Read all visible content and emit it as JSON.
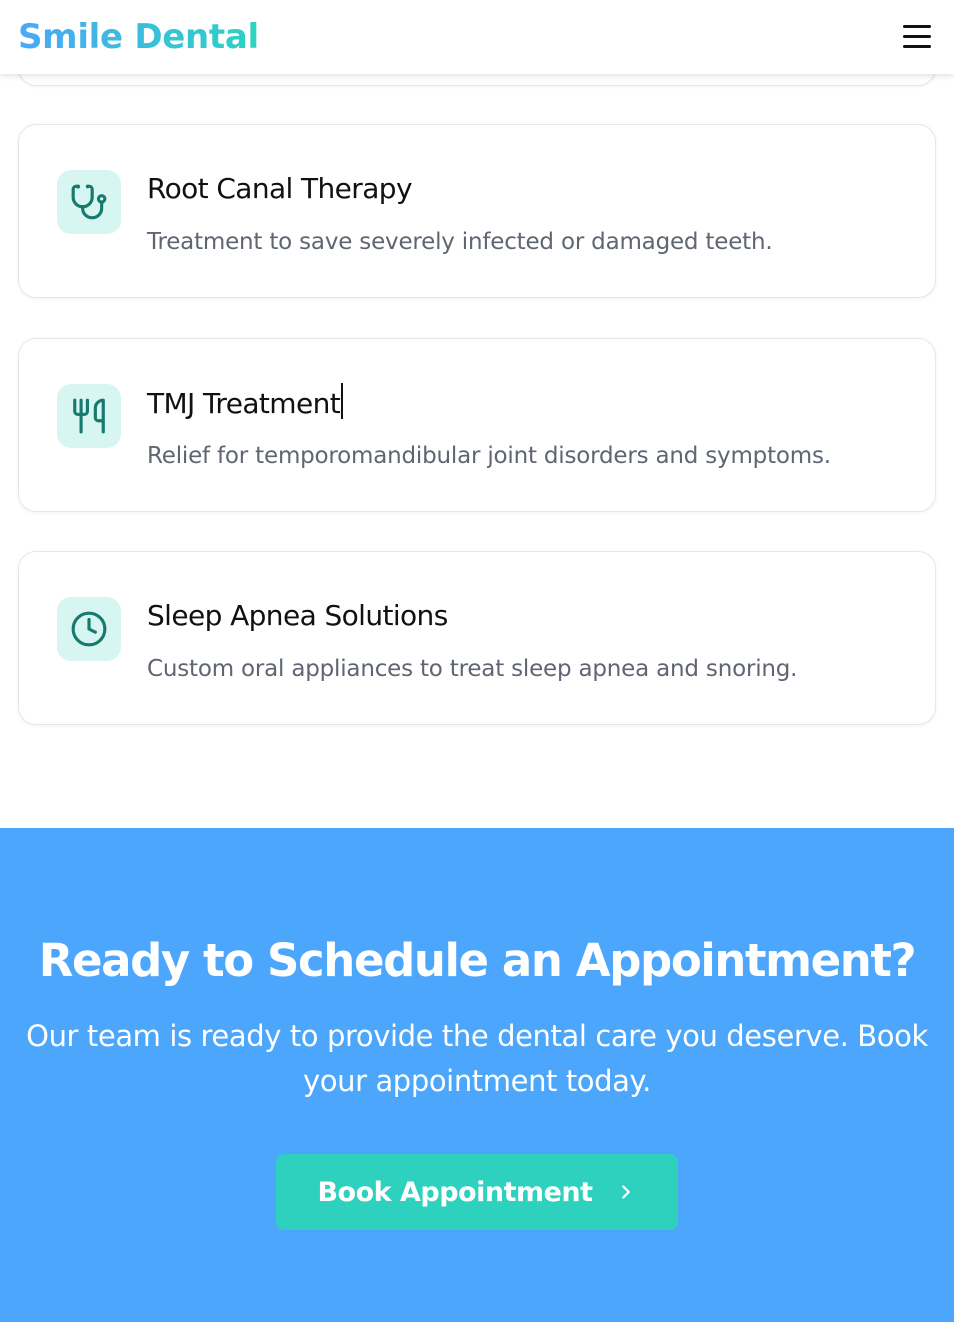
{
  "header": {
    "brand": "Smile Dental",
    "menu_icon": "hamburger-menu-icon"
  },
  "services": [
    {
      "icon": "stethoscope-icon",
      "title": "Root Canal Therapy",
      "description": "Treatment to save severely infected or damaged teeth."
    },
    {
      "icon": "utensils-icon",
      "title": "TMJ Treatment",
      "description": "Relief for temporomandibular joint disorders and symptoms."
    },
    {
      "icon": "clock-icon",
      "title": "Sleep Apnea Solutions",
      "description": "Custom oral appliances to treat sleep apnea and snoring."
    }
  ],
  "cta": {
    "title": "Ready to Schedule an Appointment?",
    "text": "Our team is ready to provide the dental care you deserve. Book your appointment today.",
    "button_label": "Book Appointment",
    "button_icon": "chevron-right-icon"
  },
  "colors": {
    "brand_gradient_start": "#4aa8f7",
    "brand_gradient_end": "#2cd3c1",
    "icon_bg": "#d8f6f1",
    "icon_stroke": "#167a6e",
    "cta_bg": "#4ba6fc",
    "cta_button": "#2ed1bd"
  }
}
